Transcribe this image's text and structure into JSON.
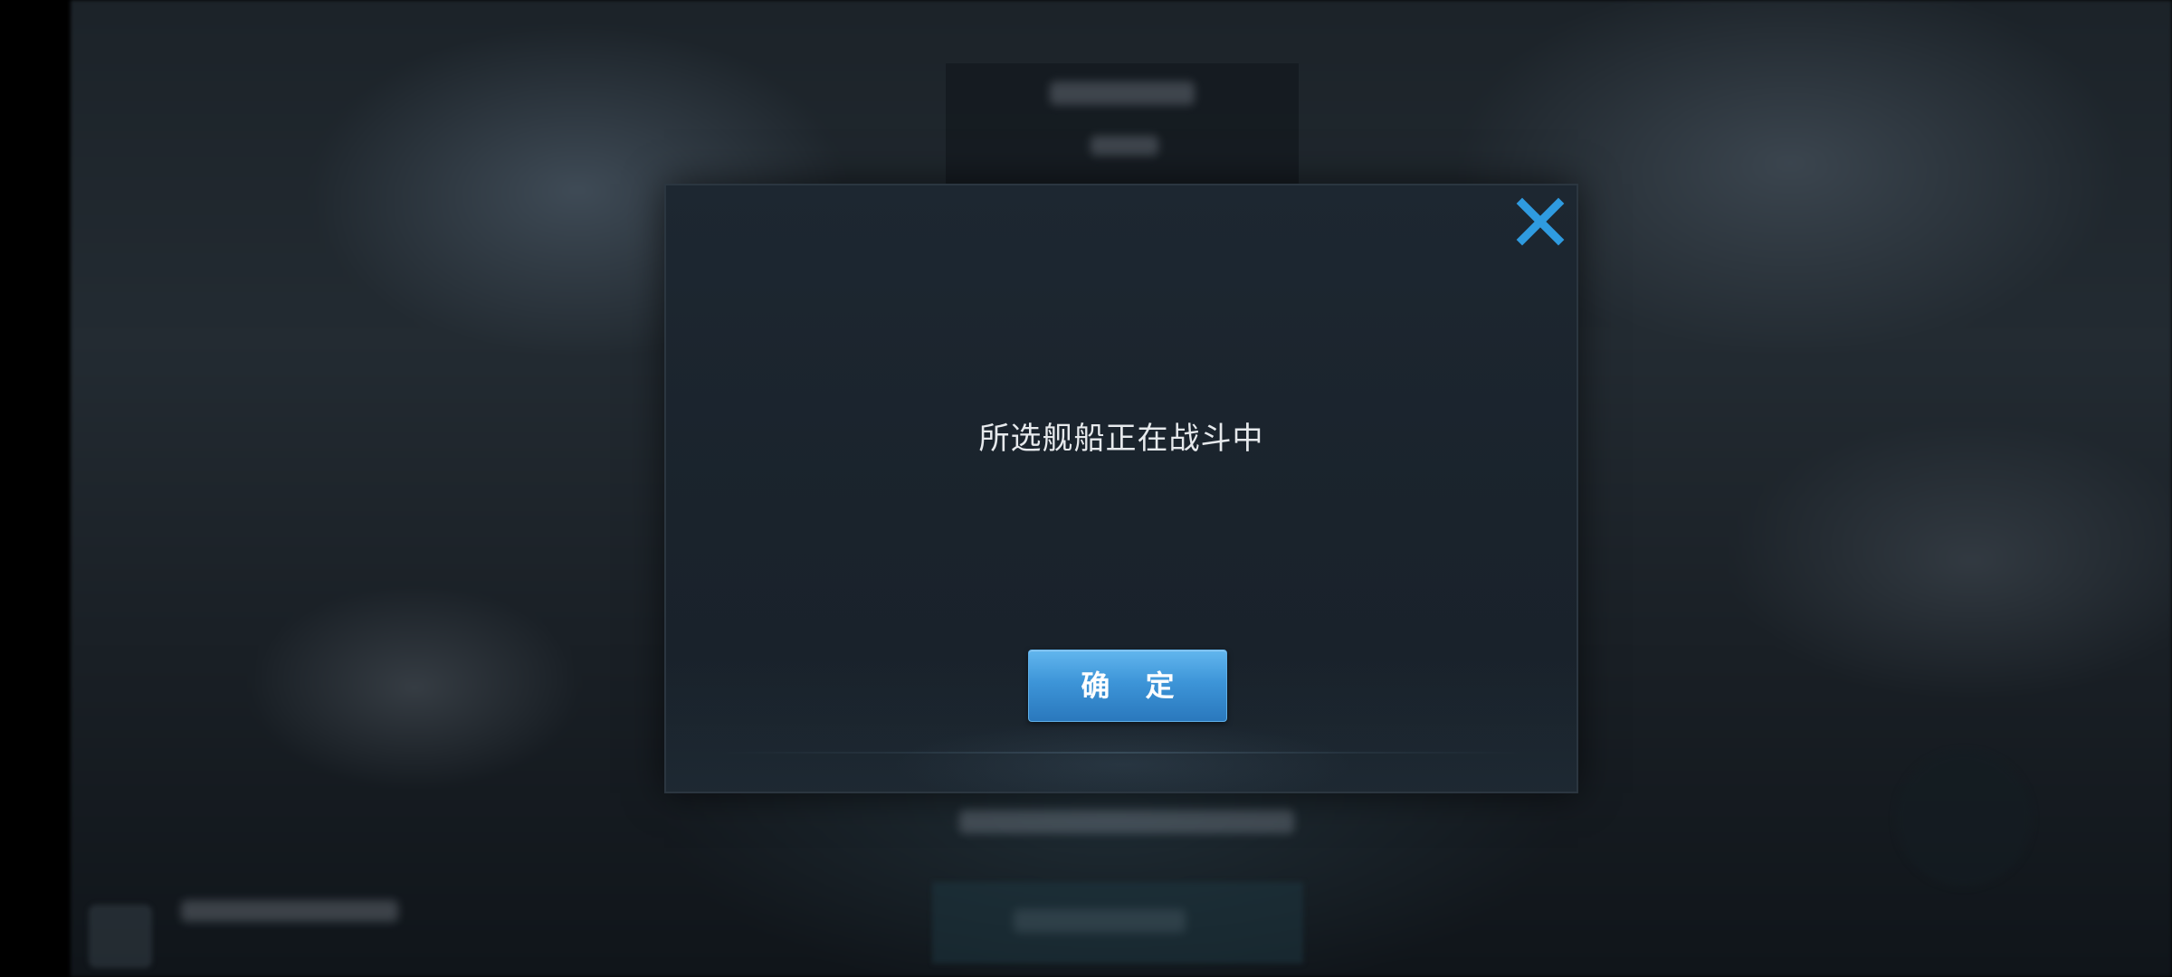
{
  "dialog": {
    "message": "所选舰船正在战斗中",
    "confirm_label": "确 定",
    "close_icon": "close-icon"
  },
  "colors": {
    "dialog_background": "#1b242d",
    "accent_blue": "#3d95d8",
    "close_icon": "#2f9be0",
    "message_text": "#e6e9ec"
  }
}
